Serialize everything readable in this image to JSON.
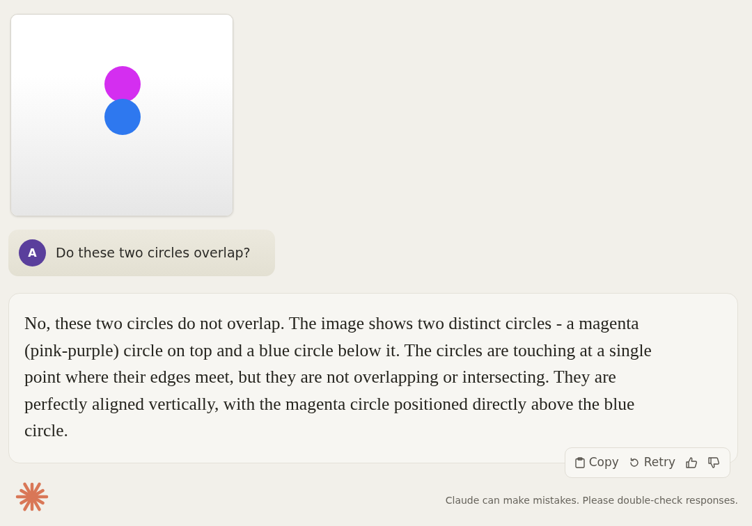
{
  "user_message": {
    "avatar": "A",
    "text": "Do these two circles overlap?"
  },
  "response": {
    "text": "No, these two circles do not overlap. The image shows two distinct circles - a magenta (pink-purple) circle on top and a blue circle below it. The circles are touching at a single point where their edges meet, but they are not overlapping or intersecting. They are perfectly aligned vertically, with the magenta circle positioned directly above the blue circle."
  },
  "actions": [
    {
      "kind": "copy",
      "label": "Copy"
    },
    {
      "kind": "retry",
      "label": "Retry"
    },
    {
      "kind": "thumbs_up"
    },
    {
      "kind": "thumbs_down"
    }
  ],
  "disclaimer": "Claude can make mistakes. Please double-check responses."
}
